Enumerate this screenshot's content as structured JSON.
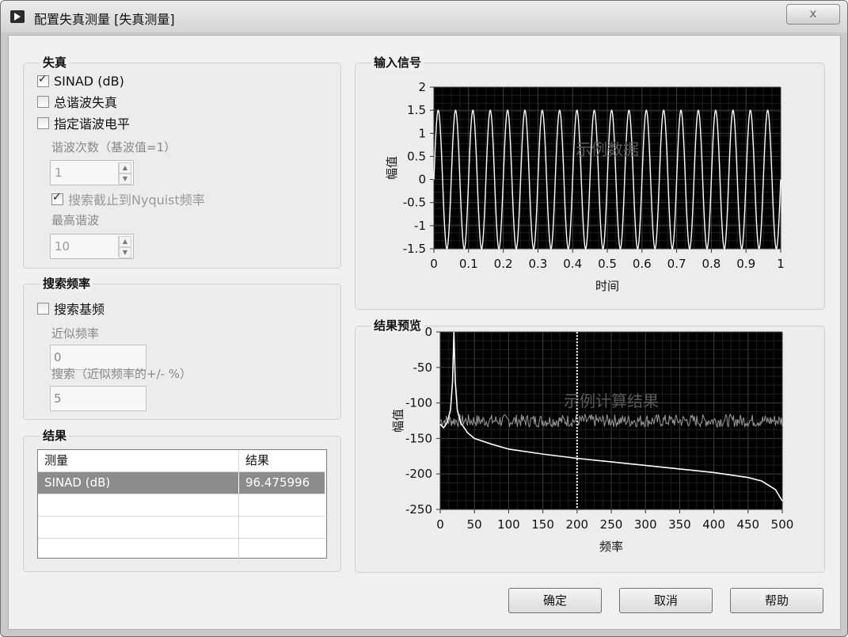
{
  "window": {
    "title": "配置失真测量 [失真测量]",
    "close_label": "x"
  },
  "distortion": {
    "title": "失真",
    "sinad_label": "SINAD (dB)",
    "sinad_checked": true,
    "thd_label": "总谐波失真",
    "thd_checked": false,
    "specified_label": "指定谐波电平",
    "specified_checked": false,
    "harmonic_label": "谐波次数（基波值=1）",
    "harmonic_value": "1",
    "nyquist_label": "搜索截止到Nyquist频率",
    "nyquist_checked": true,
    "highest_label": "最高谐波",
    "highest_value": "10"
  },
  "search_freq": {
    "title": "搜索频率",
    "search_fundamental_label": "搜索基频",
    "search_fundamental_checked": false,
    "approx_label": "近似频率",
    "approx_value": "0",
    "search_label": "搜索（近似频率的+/- %）",
    "search_value": "5"
  },
  "results": {
    "title": "结果",
    "columns": [
      "测量",
      "结果"
    ],
    "rows": [
      [
        "SINAD (dB)",
        "96.475996"
      ]
    ]
  },
  "input_signal": {
    "title": "输入信号",
    "watermark": "示例数据",
    "xlabel": "时间",
    "ylabel": "幅值",
    "x_ticks": [
      "0",
      "0.1",
      "0.2",
      "0.3",
      "0.4",
      "0.5",
      "0.6",
      "0.7",
      "0.8",
      "0.9",
      "1"
    ],
    "y_ticks": [
      "2",
      "1.5",
      "1",
      "0.5",
      "0",
      "-0.5",
      "-1",
      "-1.5"
    ]
  },
  "result_preview": {
    "title": "结果预览",
    "watermark": "示例计算结果",
    "xlabel": "频率",
    "ylabel": "幅值",
    "x_ticks": [
      "0",
      "50",
      "100",
      "150",
      "200",
      "250",
      "300",
      "350",
      "400",
      "450",
      "500"
    ],
    "y_ticks": [
      "0",
      "-50",
      "-100",
      "-150",
      "-200",
      "-250"
    ]
  },
  "chart_data": [
    {
      "type": "line",
      "title": "输入信号",
      "xlabel": "时间",
      "ylabel": "幅值",
      "xlim": [
        0,
        1
      ],
      "ylim": [
        -1.5,
        2
      ],
      "series": [
        {
          "amplitude": 1.5,
          "frequency": 20,
          "phase": 0
        }
      ],
      "grid": true
    },
    {
      "type": "line",
      "title": "结果预览",
      "xlabel": "频率",
      "ylabel": "幅值",
      "xlim": [
        0,
        500
      ],
      "ylim": [
        -250,
        0
      ],
      "series": [
        {
          "x": [
            0,
            5,
            10,
            15,
            18,
            20,
            22,
            25,
            30,
            40,
            50,
            75,
            100,
            150,
            200,
            250,
            300,
            350,
            400,
            450,
            470,
            490,
            500
          ],
          "y": [
            -130,
            -135,
            -128,
            -110,
            -70,
            0,
            -70,
            -110,
            -128,
            -142,
            -150,
            -158,
            -165,
            -172,
            -178,
            -183,
            -188,
            -193,
            -198,
            -205,
            -210,
            -222,
            -238
          ]
        },
        {
          "x": [
            0,
            50,
            100,
            150,
            200,
            250,
            300,
            350,
            400,
            450,
            500
          ],
          "y": [
            -125,
            -125,
            -125,
            -125,
            -125,
            -125,
            -125,
            -125,
            -125,
            -125,
            -125
          ]
        }
      ],
      "markers": [
        {
          "x": 200,
          "style": "dashed"
        }
      ],
      "grid": true
    }
  ],
  "buttons": {
    "ok": "确定",
    "cancel": "取消",
    "help": "帮助"
  },
  "colors": {
    "plot_bg": "#000000",
    "grid": "#3a3a3a",
    "trace": "#ffffff",
    "noise_trace": "#9a9a9a"
  }
}
